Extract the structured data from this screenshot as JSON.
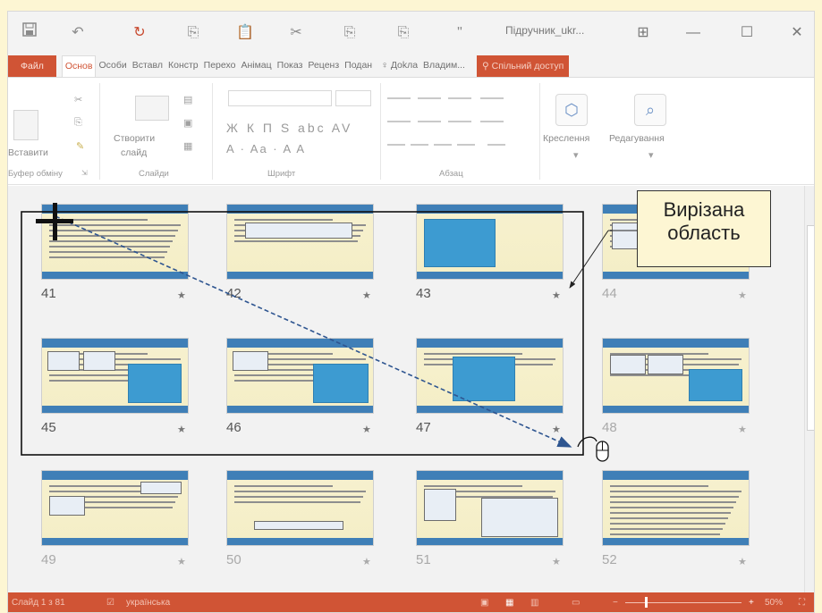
{
  "window": {
    "doc_title": "Підручник_ukr...",
    "icons": [
      "save-icon",
      "undo-icon",
      "redo-icon",
      "copy-icon",
      "paste-icon",
      "cut-icon",
      "format-painter-icon",
      "paste-special-icon",
      "quote-icon"
    ],
    "controls": [
      "ribbon-display-icon",
      "minimize-icon",
      "maximize-icon",
      "close-icon"
    ]
  },
  "tabs": {
    "file": "Файл",
    "items": [
      "Основ",
      "Особи",
      "Вставл",
      "Констр",
      "Перехо",
      "Анімац",
      "Показ",
      "Реценз",
      "Подан"
    ],
    "active": "Основ",
    "tell_me": "Дokла",
    "user": "Владим...",
    "share": "Спільний доступ"
  },
  "ribbon": {
    "clipboard": {
      "paste": "Вставити",
      "label": "Буфер обміну"
    },
    "slides": {
      "new_slide": "Створити",
      "new_slide_2": "слайд",
      "label": "Слайди"
    },
    "font": {
      "label": "Шрифт",
      "row1": "Ж К П S abc AV",
      "row2": "A · Aa · A A"
    },
    "paragraph": {
      "label": "Абзац"
    },
    "drawing": {
      "label": "Креслення"
    },
    "editing": {
      "label": "Редагування"
    }
  },
  "slides": [
    {
      "num": "41",
      "dim": false
    },
    {
      "num": "42",
      "dim": false
    },
    {
      "num": "43",
      "dim": false
    },
    {
      "num": "44",
      "dim": true
    },
    {
      "num": "45",
      "dim": false
    },
    {
      "num": "46",
      "dim": false
    },
    {
      "num": "47",
      "dim": false
    },
    {
      "num": "48",
      "dim": true
    },
    {
      "num": "49",
      "dim": true
    },
    {
      "num": "50",
      "dim": true
    },
    {
      "num": "51",
      "dim": true
    },
    {
      "num": "52",
      "dim": true
    }
  ],
  "statusbar": {
    "slide_info": "Слайд 1 з 81",
    "language": "українська",
    "zoom": "50%"
  },
  "annotation": {
    "callout_line1": "Вирізана",
    "callout_line2": "область"
  },
  "colors": {
    "accent": "#d05435",
    "page_bg": "#fdf6d3",
    "selection_arrow": "#2e5590"
  }
}
